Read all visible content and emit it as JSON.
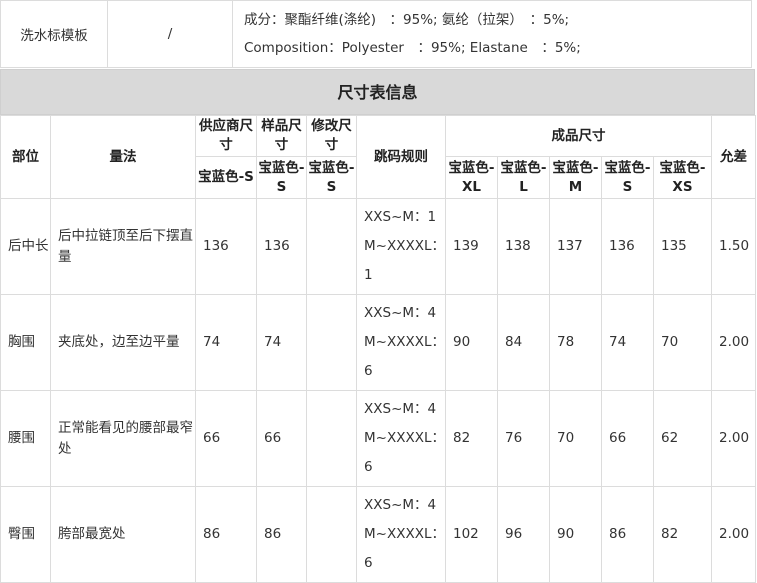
{
  "wash_label": {
    "name": "洗水标模板",
    "slash": "/",
    "composition_cn": "成分：聚酯纤维(涤纶)　：95%;  氨纶（拉架）　：5%;",
    "composition_en": "Composition：Polyester　：95%;  Elastane　：5%;"
  },
  "size_table": {
    "title": "尺寸表信息",
    "headers": {
      "part": "部位",
      "measure": "量法",
      "supplier": "供应商尺寸",
      "sample": "样品尺寸",
      "modified": "修改尺寸",
      "grading": "跳码规则",
      "finished": "成品尺寸",
      "tolerance": "允差",
      "supplier_sub": "宝蓝色-S",
      "sample_sub": "宝蓝色-S",
      "modified_sub": "宝蓝色-S",
      "finished_sizes": [
        "宝蓝色-XL",
        "宝蓝色-L",
        "宝蓝色-M",
        "宝蓝色-S",
        "宝蓝色-XS"
      ]
    },
    "rows": [
      {
        "part": "后中长",
        "measure": "后中拉链顶至后下摆直量",
        "supplier": "136",
        "sample": "136",
        "modified": "",
        "rule1": "XXS~M：1",
        "rule2": "M~XXXXL：1",
        "sizes": [
          "139",
          "138",
          "137",
          "136",
          "135"
        ],
        "tolerance": "1.50"
      },
      {
        "part": "胸围",
        "measure": "夹底处，边至边平量",
        "supplier": "74",
        "sample": "74",
        "modified": "",
        "rule1": "XXS~M：4",
        "rule2": "M~XXXXL：6",
        "sizes": [
          "90",
          "84",
          "78",
          "74",
          "70"
        ],
        "tolerance": "2.00"
      },
      {
        "part": "腰围",
        "measure": "正常能看见的腰部最窄处",
        "supplier": "66",
        "sample": "66",
        "modified": "",
        "rule1": "XXS~M：4",
        "rule2": "M~XXXXL：6",
        "sizes": [
          "82",
          "76",
          "70",
          "66",
          "62"
        ],
        "tolerance": "2.00"
      },
      {
        "part": "臀围",
        "measure": "胯部最宽处",
        "supplier": "86",
        "sample": "86",
        "modified": "",
        "rule1": "XXS~M：4",
        "rule2": "M~XXXXL：6",
        "sizes": [
          "102",
          "96",
          "90",
          "86",
          "82"
        ],
        "tolerance": "2.00"
      }
    ]
  }
}
